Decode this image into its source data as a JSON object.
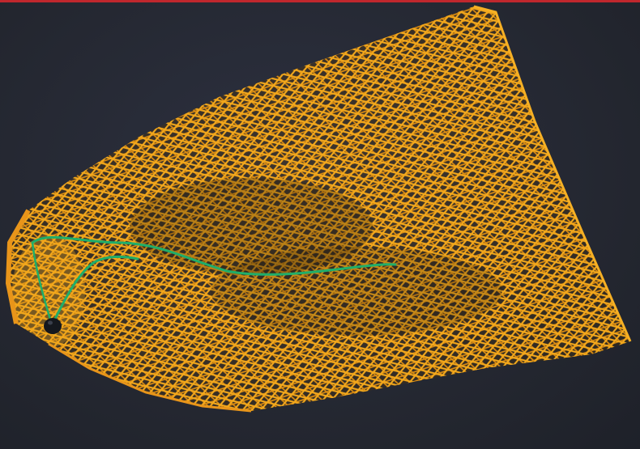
{
  "photo": {
    "subject": "mesh-bag",
    "colors": {
      "background": "#262a36",
      "accent_stripe": "#c0272d",
      "mesh": "#f0a21a",
      "mesh_shadow": "#b36a10",
      "drawstring": "#1fae6a",
      "toggle": "#15181e"
    }
  }
}
